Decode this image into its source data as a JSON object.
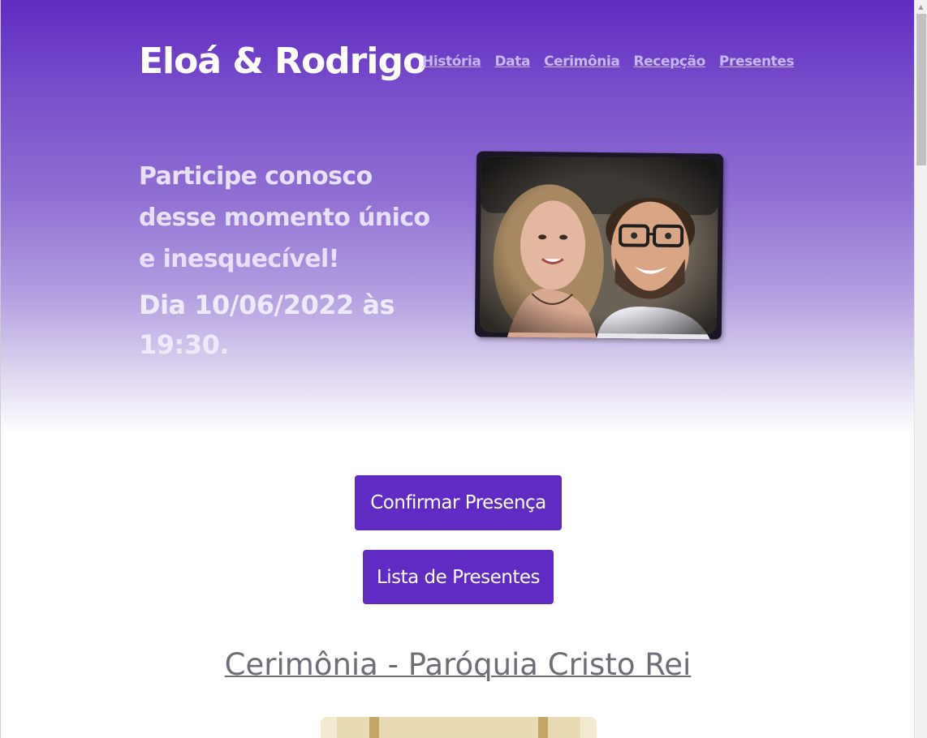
{
  "header": {
    "brand": "Eloá & Rodrigo",
    "nav": [
      "História",
      "Data",
      "Cerimônia",
      "Recepção",
      "Presentes"
    ]
  },
  "hero": {
    "tagline": "Participe conosco desse momento único e inesquecível!",
    "date_text": "Dia 10/06/2022 às 19:30."
  },
  "actions": {
    "rsvp_label": "Confirmar Presença",
    "gifts_label": "Lista de Presentes"
  },
  "ceremony": {
    "title": "Cerimônia - Paróquia Cristo Rei"
  },
  "colors": {
    "accent": "#5f2bc2",
    "nav_link": "#c5b8ef",
    "section_title": "#6e6e78"
  },
  "icons": {
    "scroll_up": "triangle-up"
  }
}
